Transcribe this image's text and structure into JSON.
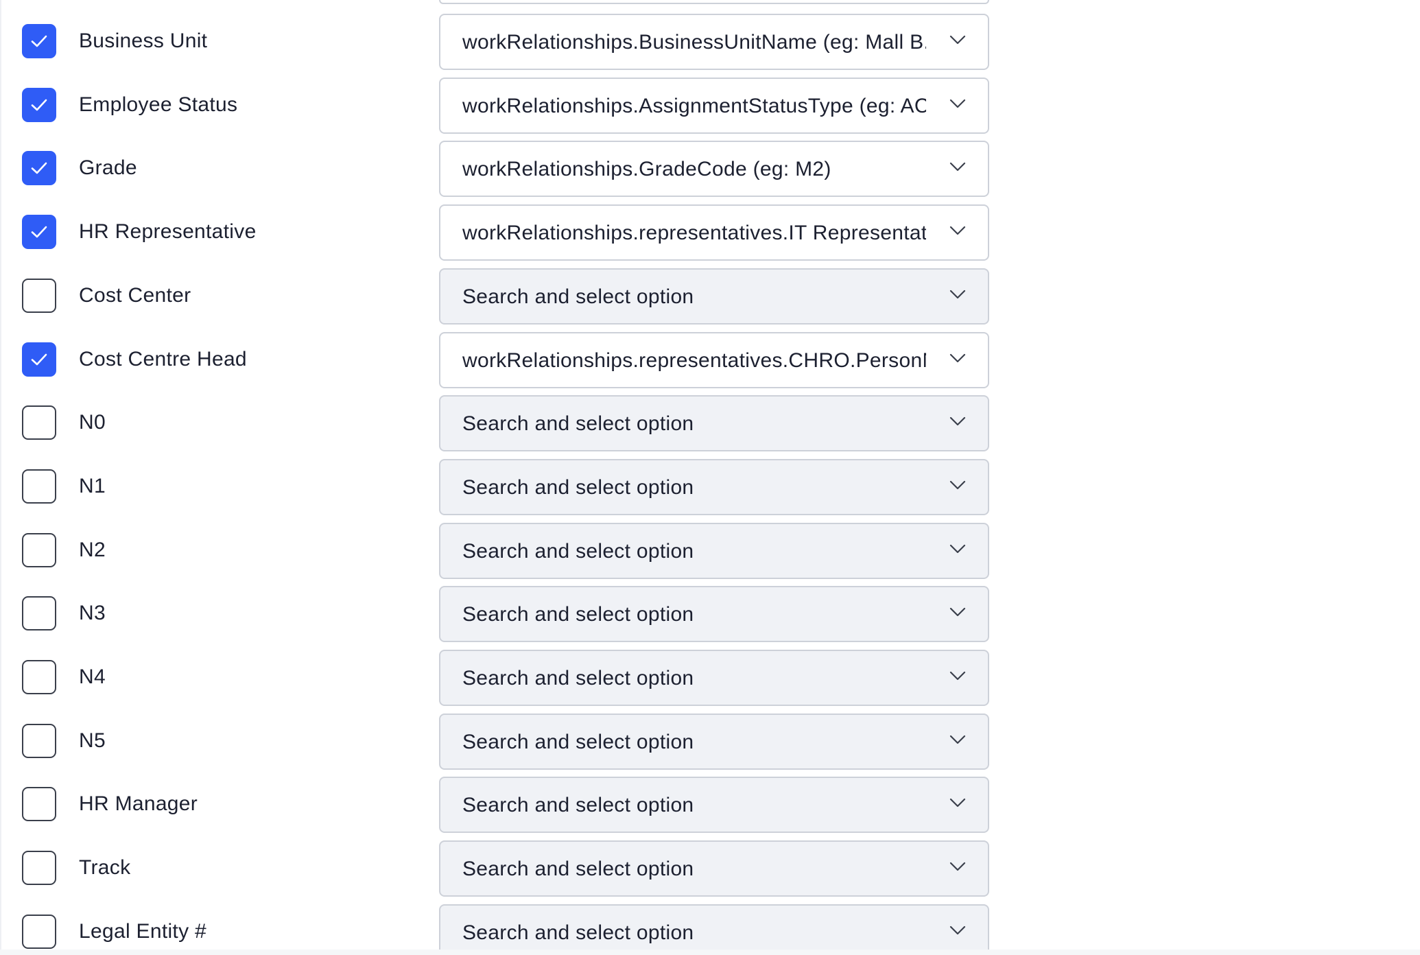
{
  "rows": [
    {
      "label": "Business Unit",
      "checked": true,
      "value": "workRelationships.BusinessUnitName (eg: Mall B...",
      "placeholder": "Search and select option"
    },
    {
      "label": "Employee Status",
      "checked": true,
      "value": "workRelationships.AssignmentStatusType (eg: AC..",
      "placeholder": "Search and select option"
    },
    {
      "label": "Grade",
      "checked": true,
      "value": "workRelationships.GradeCode (eg: M2)",
      "placeholder": "Search and select option"
    },
    {
      "label": "HR Representative",
      "checked": true,
      "value": "workRelationships.representatives.IT Representati.",
      "placeholder": "Search and select option"
    },
    {
      "label": "Cost Center",
      "checked": false,
      "value": "",
      "placeholder": "Search and select option"
    },
    {
      "label": "Cost Centre Head",
      "checked": true,
      "value": "workRelationships.representatives.CHRO.PersonN.",
      "placeholder": "Search and select option"
    },
    {
      "label": "N0",
      "checked": false,
      "value": "",
      "placeholder": "Search and select option"
    },
    {
      "label": "N1",
      "checked": false,
      "value": "",
      "placeholder": "Search and select option"
    },
    {
      "label": "N2",
      "checked": false,
      "value": "",
      "placeholder": "Search and select option"
    },
    {
      "label": "N3",
      "checked": false,
      "value": "",
      "placeholder": "Search and select option"
    },
    {
      "label": "N4",
      "checked": false,
      "value": "",
      "placeholder": "Search and select option"
    },
    {
      "label": "N5",
      "checked": false,
      "value": "",
      "placeholder": "Search and select option"
    },
    {
      "label": "HR Manager",
      "checked": false,
      "value": "",
      "placeholder": "Search and select option"
    },
    {
      "label": "Track",
      "checked": false,
      "value": "",
      "placeholder": "Search and select option"
    },
    {
      "label": "Legal Entity #",
      "checked": false,
      "value": "",
      "placeholder": "Search and select option"
    }
  ],
  "colors": {
    "checkbox_checked": "#2f5cf6",
    "checkbox_border": "#3a3f4b",
    "select_border": "#cdd1d9",
    "select_empty_bg": "#f0f2f6",
    "text": "#1c2030"
  },
  "icons": {
    "check": "check-icon",
    "dropdown": "chevron-down-icon"
  }
}
